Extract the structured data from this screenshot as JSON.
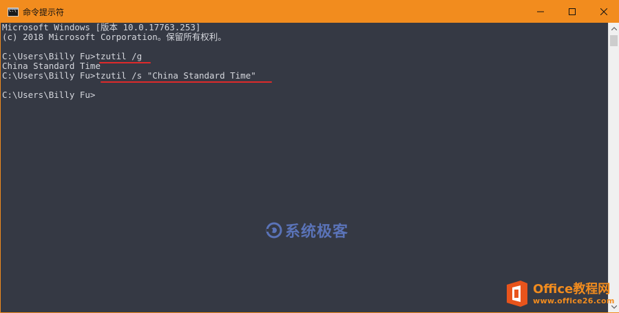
{
  "window": {
    "title": "命令提示符",
    "controls": {
      "minimize_icon": "minimize-icon",
      "maximize_icon": "maximize-icon",
      "close_icon": "close-icon"
    },
    "accent_color": "#f28c1e"
  },
  "console": {
    "background": "#353944",
    "lines": [
      "Microsoft Windows [版本 10.0.17763.253]",
      "(c) 2018 Microsoft Corporation。保留所有权利。",
      "",
      "C:\\Users\\Billy Fu>tzutil /g",
      "China Standard Time",
      "C:\\Users\\Billy Fu>tzutil /s \"China Standard Time\"",
      "",
      "C:\\Users\\Billy Fu>"
    ],
    "highlight_color": "#e02a2a"
  },
  "watermarks": {
    "center_text": "系统极客",
    "corner_brand": "Office教程网",
    "corner_url": "www.office26.com"
  }
}
